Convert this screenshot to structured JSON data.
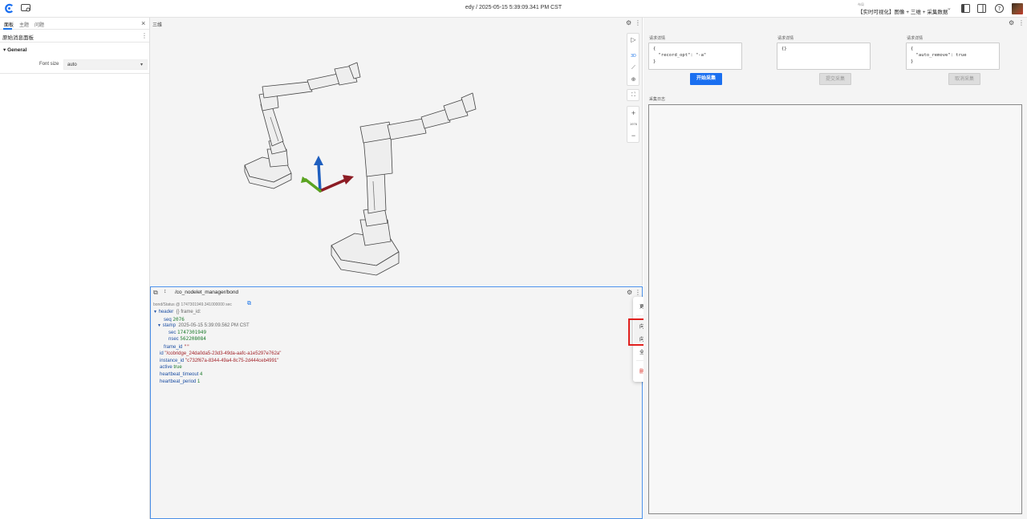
{
  "topbar": {
    "title": "edy / 2025-05-15 5:39:09.341 PM CST",
    "layout_small_label": "布局",
    "layout_name": "【实时可视化】图像 + 三维 + 采集数据",
    "layout_caret": "⌄"
  },
  "left_panel": {
    "tabs": [
      "面板",
      "主题",
      "问题"
    ],
    "close": "×",
    "subtitle": "原始消息面板",
    "kebab": "⋮",
    "section": "▾  General",
    "font_size_label": "Font size",
    "font_size_value": "auto",
    "select_caret": "▾"
  },
  "panel_3d": {
    "title": "三维",
    "gear": "⚙",
    "kebab": "⋮",
    "toolbar": {
      "play": "▷",
      "mode_3d": "3D",
      "ruler": "⟋",
      "pin": "⊕",
      "focus": "⛶",
      "zoom_in": "+",
      "zoom_level": "1976",
      "zoom_out": "−"
    }
  },
  "panel_raw": {
    "icon1": "⧉",
    "icon2": "↕",
    "topic": "/co_nodelet_manager/bond",
    "gear": "⚙",
    "kebab": "⋮",
    "meta": "bond/Status @ 1747301949.341000000 sec",
    "copy": "⧉",
    "tree": {
      "header_key": "header",
      "header_summary": "{} frame_id:",
      "seq_key": "seq",
      "seq_val": "2076",
      "stamp_key": "stamp",
      "stamp_summary": "2025-05-15 5:39:09.562 PM CST",
      "sec_key": "sec",
      "sec_val": "1747301949",
      "nsec_key": "nsec",
      "nsec_val": "562208084",
      "frame_id_key": "frame_id",
      "frame_id_val": "\"\"",
      "id_key": "id",
      "id_val": "\"/cobridge_24da0da5-23d3-49da-aafc-a1e5297e762a\"",
      "instance_id_key": "instance_id",
      "instance_id_val": "\"c732f67a-8344-49a4-8c75-2d444ceb4991\"",
      "active_key": "active",
      "active_val": "true",
      "hb_timeout_key": "heartbeat_timeout",
      "hb_timeout_val": "4",
      "hb_period_key": "heartbeat_period",
      "hb_period_val": "1"
    }
  },
  "context_menu": {
    "change_panel": "更改面板",
    "chevron": "›",
    "split_right": "向右拆分",
    "split_down": "向下拆分",
    "fullscreen": "全屏",
    "delete_panel": "删除面板"
  },
  "right_panel": {
    "gear": "⚙",
    "kebab": "⋮",
    "req_labels": [
      "请求详情",
      "请求详情",
      "请求详情"
    ],
    "req_bodies": [
      "{\n  \"record_opt\": \"-a\"\n}",
      "{}",
      "{\n  \"auto_remove\": true\n}"
    ],
    "btn_start": "开始采集",
    "btn_submit": "提交采集",
    "btn_cancel": "取消采集",
    "log_label": "采集日志"
  },
  "colors": {
    "accent": "#1a6ff0",
    "panel_focus_border": "#4a8fe7",
    "danger": "#d93025",
    "highlight_box": "#e0201e"
  }
}
